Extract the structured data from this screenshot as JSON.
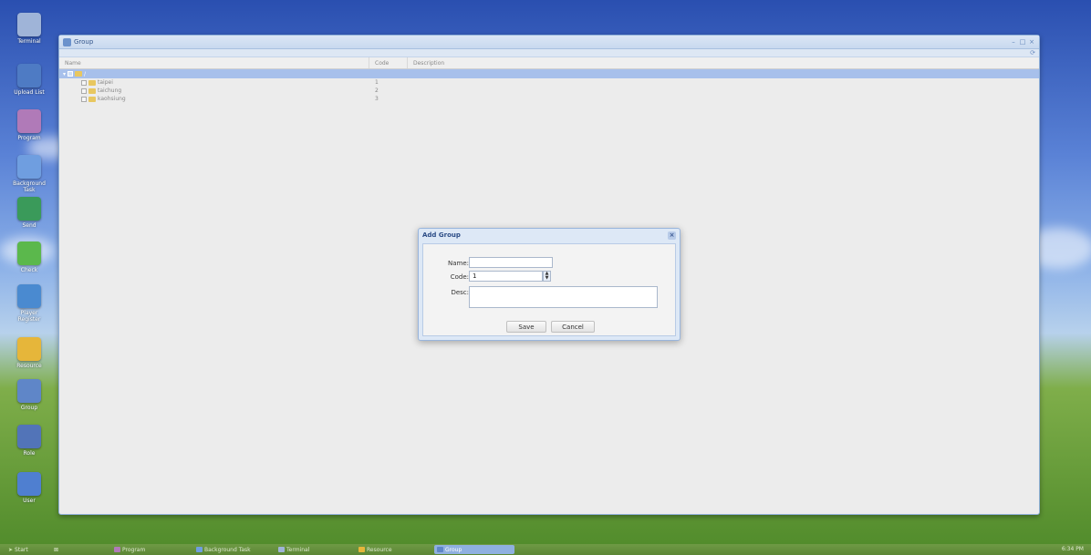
{
  "desktop": {
    "icons": [
      {
        "label": "Terminal",
        "icon": "monitor-icon",
        "color": "#9fb4d8"
      },
      {
        "label": "Upload List",
        "icon": "upload-arrow-icon",
        "color": "#4e7bc4"
      },
      {
        "label": "Program",
        "icon": "program-icon",
        "color": "#b07ab8"
      },
      {
        "label": "Background Task",
        "icon": "list-icon",
        "color": "#6f9ee0"
      },
      {
        "label": "Send",
        "icon": "send-icon",
        "color": "#3a9a5a"
      },
      {
        "label": "Check",
        "icon": "check-icon",
        "color": "#5bb84c"
      },
      {
        "label": "Player Register",
        "icon": "key-icon",
        "color": "#4a8ad0"
      },
      {
        "label": "Resource",
        "icon": "folder-icon",
        "color": "#e6b63a"
      },
      {
        "label": "Group",
        "icon": "group-icon",
        "color": "#5f86c8"
      },
      {
        "label": "Role",
        "icon": "role-icon",
        "color": "#5274b8"
      },
      {
        "label": "User",
        "icon": "user-icon",
        "color": "#4f7fd0"
      }
    ]
  },
  "window": {
    "title": "Group",
    "columns": {
      "name": "Name",
      "code": "Code",
      "description": "Description"
    },
    "root_label": "/",
    "rows": [
      {
        "name": "taipei",
        "code": "1"
      },
      {
        "name": "taichung",
        "code": "2"
      },
      {
        "name": "kaohsiung",
        "code": "3"
      }
    ]
  },
  "dialog": {
    "title": "Add Group",
    "name_label": "Name:",
    "name_value": "",
    "code_label": "Code:",
    "code_value": "1",
    "desc_label": "Desc:",
    "desc_value": "",
    "save_label": "Save",
    "cancel_label": "Cancel"
  },
  "taskbar": {
    "start_label": "Start",
    "tasks": [
      {
        "label": "Program",
        "icon": "program-icon",
        "color": "#b07ab8"
      },
      {
        "label": "Background Task",
        "icon": "list-icon",
        "color": "#6f9ee0"
      },
      {
        "label": "Terminal",
        "icon": "monitor-icon",
        "color": "#9fb4d8"
      },
      {
        "label": "Resource",
        "icon": "folder-icon",
        "color": "#e6b63a"
      },
      {
        "label": "Group",
        "icon": "group-icon",
        "color": "#5f86c8"
      }
    ],
    "clock": "6:34 PM"
  }
}
